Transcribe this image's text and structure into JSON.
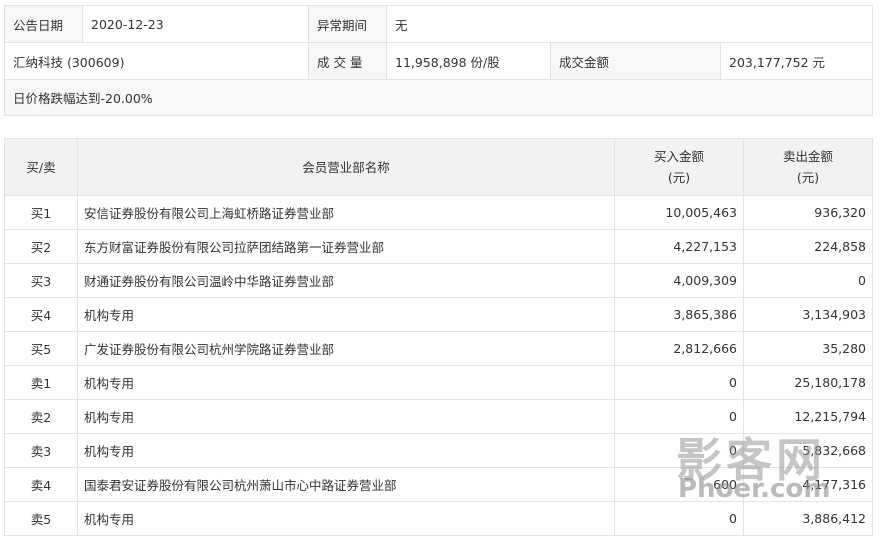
{
  "info": {
    "announce_date_label": "公告日期",
    "announce_date": "2020-12-23",
    "abnormal_period_label": "异常期间",
    "abnormal_period": "无",
    "stock": "汇纳科技 (300609)",
    "volume_label": "成 交 量",
    "volume": "11,958,898 份/股",
    "amount_label": "成交金额",
    "amount": "203,177,752 元",
    "reason": "日价格跌幅达到-20.00%"
  },
  "table": {
    "headers": {
      "side": "买/卖",
      "member": "会员营业部名称",
      "buy_line1": "买入金额",
      "buy_line2": "(元)",
      "sell_line1": "卖出金额",
      "sell_line2": "(元)"
    },
    "rows": [
      {
        "side": "买1",
        "name": "安信证券股份有限公司上海虹桥路证券营业部",
        "buy": "10,005,463",
        "sell": "936,320"
      },
      {
        "side": "买2",
        "name": "东方财富证券股份有限公司拉萨团结路第一证券营业部",
        "buy": "4,227,153",
        "sell": "224,858"
      },
      {
        "side": "买3",
        "name": "财通证券股份有限公司温岭中华路证券营业部",
        "buy": "4,009,309",
        "sell": "0"
      },
      {
        "side": "买4",
        "name": "机构专用",
        "buy": "3,865,386",
        "sell": "3,134,903"
      },
      {
        "side": "买5",
        "name": "广发证券股份有限公司杭州学院路证券营业部",
        "buy": "2,812,666",
        "sell": "35,280"
      },
      {
        "side": "卖1",
        "name": "机构专用",
        "buy": "0",
        "sell": "25,180,178"
      },
      {
        "side": "卖2",
        "name": "机构专用",
        "buy": "0",
        "sell": "12,215,794"
      },
      {
        "side": "卖3",
        "name": "机构专用",
        "buy": "0",
        "sell": "5,832,668"
      },
      {
        "side": "卖4",
        "name": "国泰君安证券股份有限公司杭州萧山市心中路证券营业部",
        "buy": "600",
        "sell": "4,177,316"
      },
      {
        "side": "卖5",
        "name": "机构专用",
        "buy": "0",
        "sell": "3,886,412"
      }
    ]
  },
  "watermark": {
    "cn": "影客网",
    "en": "Phoer.com"
  }
}
